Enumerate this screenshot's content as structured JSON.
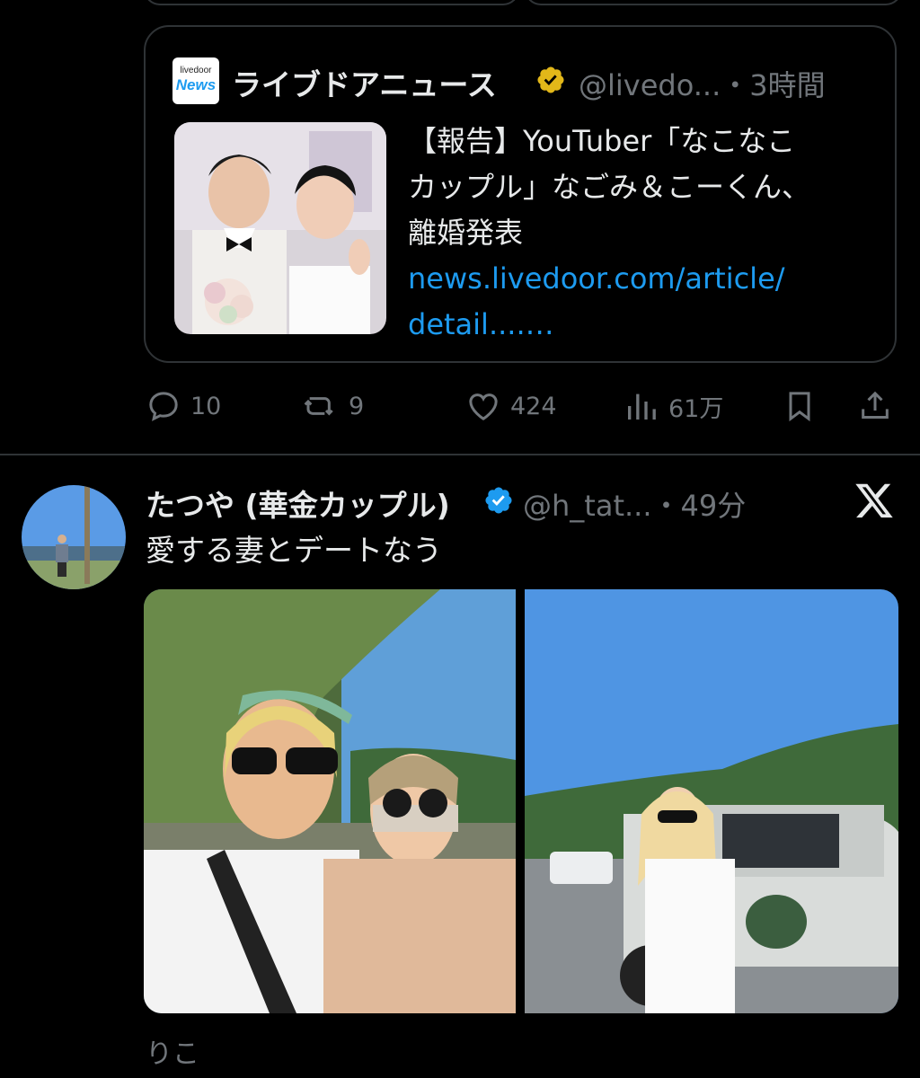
{
  "quoted": {
    "logo_small": "livedoor",
    "logo_big": "News",
    "name": "ライブドアニュース",
    "handle_time": "@livedo...・3時間",
    "text_lines": [
      "【報告】YouTuber「なこなこ",
      "カップル」なごみ＆こーくん、",
      "離婚発表"
    ],
    "link_lines": [
      "news.livedoor.com/article/",
      "detail....…"
    ]
  },
  "actions": {
    "reply_count": "10",
    "retweet_count": "9",
    "like_count": "424",
    "views_count": "61万"
  },
  "tweet": {
    "name": "たつや (華金カップル)",
    "handle_time": "@h_tat...・49分",
    "text": "愛する妻とデートなう"
  },
  "caption": "りこ",
  "colors": {
    "background": "#000000",
    "text": "#e7e9ea",
    "muted": "#71767b",
    "link": "#1d9bf0",
    "border": "#2f3336",
    "verified_gold": "#e2b719",
    "verified_blue": "#1d9bf0"
  }
}
